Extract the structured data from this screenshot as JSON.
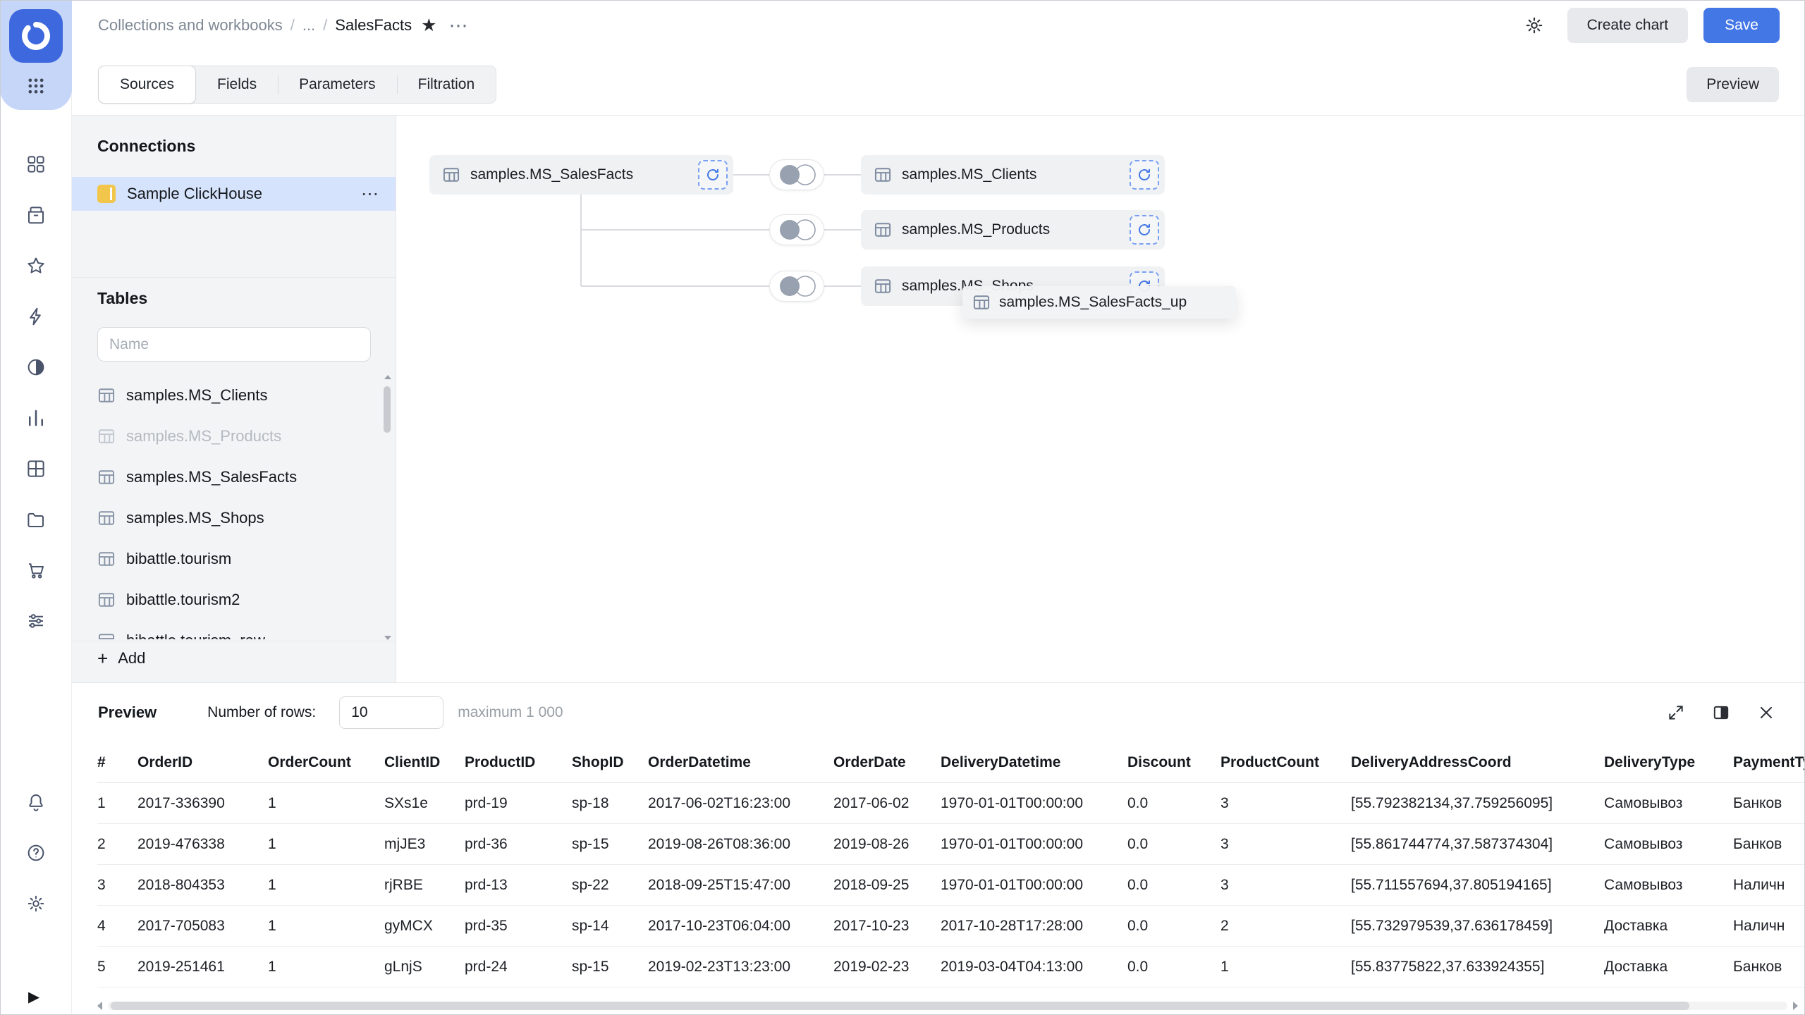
{
  "colors": {
    "accent": "#4377e6",
    "selected_row": "#d6e3fc",
    "rail_blob": "#c6d6f8",
    "logo_blue": "#3e68de",
    "ch_yellow": "#f1c64b"
  },
  "icons_glyphs": {
    "star_filled": "★",
    "more": "⋯",
    "add": "+",
    "play": "▶"
  },
  "sidebar": {
    "nav_icons": [
      "objects",
      "collections",
      "favorites",
      "connections",
      "datasets",
      "charts",
      "dashboards",
      "storage",
      "marketplace",
      "services"
    ],
    "bottom_icons": [
      "notifications",
      "help",
      "settings"
    ]
  },
  "header": {
    "breadcrumb": {
      "root": "Collections and workbooks",
      "separator": "/",
      "ellipsis": "...",
      "current": "SalesFacts"
    },
    "create_chart_label": "Create chart",
    "save_label": "Save"
  },
  "tabs": {
    "items": [
      {
        "label": "Sources",
        "active": true
      },
      {
        "label": "Fields",
        "active": false
      },
      {
        "label": "Parameters",
        "active": false
      },
      {
        "label": "Filtration",
        "active": false
      }
    ],
    "preview_label": "Preview"
  },
  "connections": {
    "title": "Connections",
    "selected": "Sample ClickHouse"
  },
  "tables_panel": {
    "title": "Tables",
    "search_placeholder": "Name",
    "items": [
      {
        "label": "samples.MS_Clients",
        "disabled": false
      },
      {
        "label": "samples.MS_Products",
        "disabled": true
      },
      {
        "label": "samples.MS_SalesFacts",
        "disabled": false
      },
      {
        "label": "samples.MS_Shops",
        "disabled": false
      },
      {
        "label": "bibattle.tourism",
        "disabled": false
      },
      {
        "label": "bibattle.tourism2",
        "disabled": false
      },
      {
        "label": "bibattle.tourism_raw",
        "disabled": false
      }
    ],
    "add_label": "Add"
  },
  "canvas": {
    "root_node": "samples.MS_SalesFacts",
    "joined_nodes": [
      "samples.MS_Clients",
      "samples.MS_Products",
      "samples.MS_Shops"
    ],
    "drag_node": "samples.MS_SalesFacts_up"
  },
  "preview": {
    "title": "Preview",
    "rows_label": "Number of rows:",
    "rows_value": "10",
    "max_label": "maximum 1 000",
    "columns": [
      "#",
      "OrderID",
      "OrderCount",
      "ClientID",
      "ProductID",
      "ShopID",
      "OrderDatetime",
      "OrderDate",
      "DeliveryDatetime",
      "Discount",
      "ProductCount",
      "DeliveryAddressCoord",
      "DeliveryType",
      "PaymentType"
    ],
    "rows": [
      [
        "1",
        "2017-336390",
        "1",
        "SXs1e",
        "prd-19",
        "sp-18",
        "2017-06-02T16:23:00",
        "2017-06-02",
        "1970-01-01T00:00:00",
        "0.0",
        "3",
        "[55.792382134,37.759256095]",
        "Самовывоз",
        "Банков"
      ],
      [
        "2",
        "2019-476338",
        "1",
        "mjJE3",
        "prd-36",
        "sp-15",
        "2019-08-26T08:36:00",
        "2019-08-26",
        "1970-01-01T00:00:00",
        "0.0",
        "3",
        "[55.861744774,37.587374304]",
        "Самовывоз",
        "Банков"
      ],
      [
        "3",
        "2018-804353",
        "1",
        "rjRBE",
        "prd-13",
        "sp-22",
        "2018-09-25T15:47:00",
        "2018-09-25",
        "1970-01-01T00:00:00",
        "0.0",
        "3",
        "[55.711557694,37.805194165]",
        "Самовывоз",
        "Наличн"
      ],
      [
        "4",
        "2017-705083",
        "1",
        "gyMCX",
        "prd-35",
        "sp-14",
        "2017-10-23T06:04:00",
        "2017-10-23",
        "2017-10-28T17:28:00",
        "0.0",
        "2",
        "[55.732979539,37.636178459]",
        "Доставка",
        "Наличн"
      ],
      [
        "5",
        "2019-251461",
        "1",
        "gLnjS",
        "prd-24",
        "sp-15",
        "2019-02-23T13:23:00",
        "2019-02-23",
        "2019-03-04T04:13:00",
        "0.0",
        "1",
        "[55.83775822,37.633924355]",
        "Доставка",
        "Банков"
      ]
    ]
  }
}
